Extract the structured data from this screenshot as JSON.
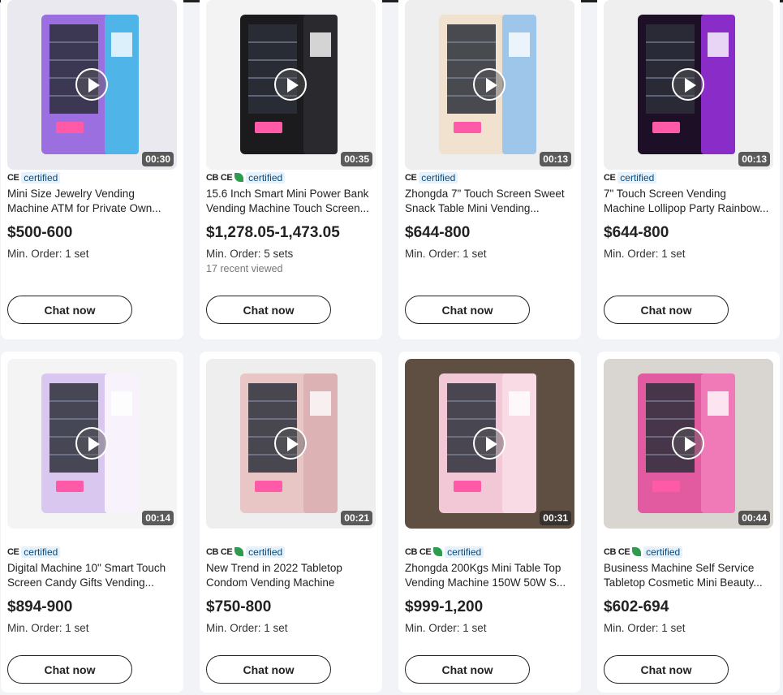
{
  "products": [
    {
      "duration": "00:30",
      "certs": [
        "CE"
      ],
      "cert_label": "certified",
      "title1": "Mini Size Jewelry Vending",
      "title2": "Machine ATM for Private Own...",
      "price": "$500-600",
      "moq": "Min. Order: 1 set",
      "viewed": "",
      "chat": "Chat now",
      "bg": "#e9e9ef",
      "m1": "#9b6fe0",
      "m2": "#4fb4e8",
      "screen": "",
      "push": "Push"
    },
    {
      "duration": "00:35",
      "certs": [
        "CB",
        "CE",
        "leaf"
      ],
      "cert_label": "certified",
      "title1": "15.6 Inch Smart Mini Power Bank",
      "title2": "Vending Machine Touch Screen...",
      "price": "$1,278.05-1,473.05",
      "moq": "Min. Order: 5 sets",
      "viewed": "17 recent viewed",
      "chat": "Chat now",
      "bg": "#f3f3f3",
      "m1": "#1b1b1d",
      "m2": "#2a2a2e",
      "screen": "SMART RETAIL",
      "push": "PUSH",
      "brand": "ZHONGDA SMART"
    },
    {
      "duration": "00:13",
      "certs": [
        "CE"
      ],
      "cert_label": "certified",
      "title1": "Zhongda 7\" Touch Screen Sweet",
      "title2": "Snack Table Mini Vending...",
      "price": "$644-800",
      "moq": "Min. Order: 1 set",
      "viewed": "",
      "chat": "Chat now",
      "bg": "#eeeeee",
      "m1": "#f1e2cf",
      "m2": "#9ec6ea",
      "screen": "",
      "push": "Push"
    },
    {
      "duration": "00:13",
      "certs": [
        "CE"
      ],
      "cert_label": "certified",
      "title1": "7\" Touch Screen Vending",
      "title2": "Machine Lollipop Party Rainbow...",
      "price": "$644-800",
      "moq": "Min. Order: 1 set",
      "viewed": "",
      "chat": "Chat now",
      "bg": "#efefef",
      "m1": "#1d1026",
      "m2": "#8a2cc7",
      "screen": "",
      "push": "Push"
    },
    {
      "duration": "00:14",
      "certs": [
        "CE"
      ],
      "cert_label": "certified",
      "title1": "Digital Machine 10\" Smart Touch",
      "title2": "Screen Candy Gifts Vending...",
      "price": "$894-900",
      "moq": "Min. Order: 1 set",
      "viewed": "",
      "chat": "Chat now",
      "bg": "#f4f4f4",
      "m1": "#d9c7f0",
      "m2": "#f7f2fb",
      "screen": "",
      "push": "Push"
    },
    {
      "duration": "00:21",
      "certs": [
        "CB",
        "CE",
        "leaf"
      ],
      "cert_label": "certified",
      "title1": "New Trend in 2022 Tabletop",
      "title2": "Condom Vending Machine",
      "price": "$750-800",
      "moq": "Min. Order: 1 set",
      "viewed": "",
      "chat": "Chat now",
      "bg": "#eeeeee",
      "m1": "#e8c6c6",
      "m2": "#dcb2b5",
      "screen": "",
      "push": "PUSH"
    },
    {
      "duration": "00:31",
      "certs": [
        "CB",
        "CE",
        "leaf"
      ],
      "cert_label": "certified",
      "title1": "Zhongda 200Kgs Mini Table Top",
      "title2": "Vending Machine 150W 50W S...",
      "price": "$999-1,200",
      "moq": "Min. Order: 1 set",
      "viewed": "",
      "chat": "Chat now",
      "bg": "#5f4e42",
      "m1": "#f3c8d6",
      "m2": "#f8dbe5",
      "screen": "lashes",
      "push": "PUSH"
    },
    {
      "duration": "00:44",
      "certs": [
        "CB",
        "CE",
        "leaf"
      ],
      "cert_label": "certified",
      "title1": "Business Machine Self Service",
      "title2": "Tabletop Cosmetic Mini Beauty...",
      "price": "$602-694",
      "moq": "Min. Order: 1 set",
      "viewed": "",
      "chat": "Chat now",
      "bg": "#d9d6d2",
      "m1": "#e25aa0",
      "m2": "#f07ab8",
      "screen": "",
      "push": "PUSH"
    }
  ]
}
